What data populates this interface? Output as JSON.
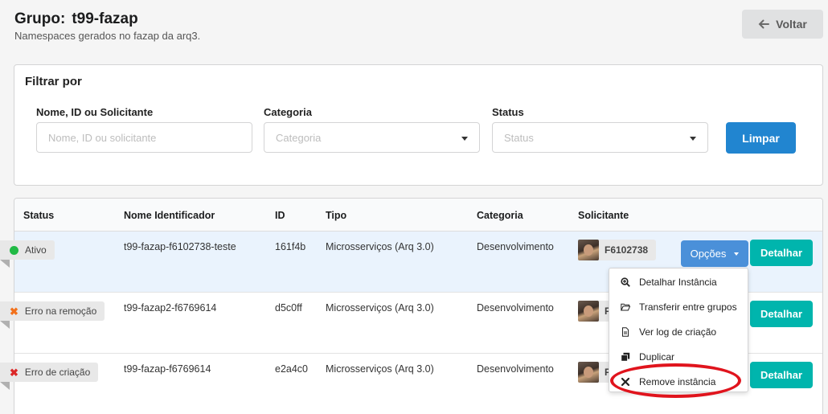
{
  "header": {
    "title_label": "Grupo:",
    "title_value": "t99-fazap",
    "subtitle": "Namespaces gerados no fazap da arq3.",
    "back_label": "Voltar"
  },
  "filter": {
    "title": "Filtrar por",
    "name_label": "Nome, ID ou Solicitante",
    "name_placeholder": "Nome, ID ou solicitante",
    "category_label": "Categoria",
    "category_placeholder": "Categoria",
    "status_label": "Status",
    "status_placeholder": "Status",
    "clear_label": "Limpar"
  },
  "table": {
    "headers": [
      "Status",
      "Nome Identificador",
      "ID",
      "Tipo",
      "Categoria",
      "Solicitante"
    ],
    "rows": [
      {
        "status": "Ativo",
        "status_icon": "green-dot",
        "name": "t99-fazap-f6102738-teste",
        "id": "161f4b",
        "type": "Microsserviços (Arq 3.0)",
        "category": "Desenvolvimento",
        "requester": "F6102738"
      },
      {
        "status": "Erro na remoção",
        "status_icon": "error-x-icon",
        "status_color": "#f2711c",
        "name": "t99-fazap2-f6769614",
        "id": "d5c0ff",
        "type": "Microsserviços (Arq 3.0)",
        "category": "Desenvolvimento",
        "requester": "F"
      },
      {
        "status": "Erro de criação",
        "status_icon": "error-x-icon",
        "status_color": "#db2828",
        "name": "t99-fazap-f6769614",
        "id": "e2a4c0",
        "type": "Microsserviços (Arq 3.0)",
        "category": "Desenvolvimento",
        "requester": "F"
      }
    ],
    "options_label": "Opções",
    "detail_label": "Detalhar"
  },
  "menu": {
    "items": [
      {
        "label": "Detalhar Instância",
        "icon": "zoom-in-icon"
      },
      {
        "label": "Transferir entre grupos",
        "icon": "folder-open-icon"
      },
      {
        "label": "Ver log de criação",
        "icon": "file-icon"
      },
      {
        "label": "Duplicar",
        "icon": "copy-icon"
      },
      {
        "label": "Remove instância",
        "icon": "close-icon"
      }
    ]
  },
  "colors": {
    "primary": "#2185d0",
    "teal": "#00b5ad",
    "highlight": "#e0141d",
    "active": "#21ba45"
  }
}
